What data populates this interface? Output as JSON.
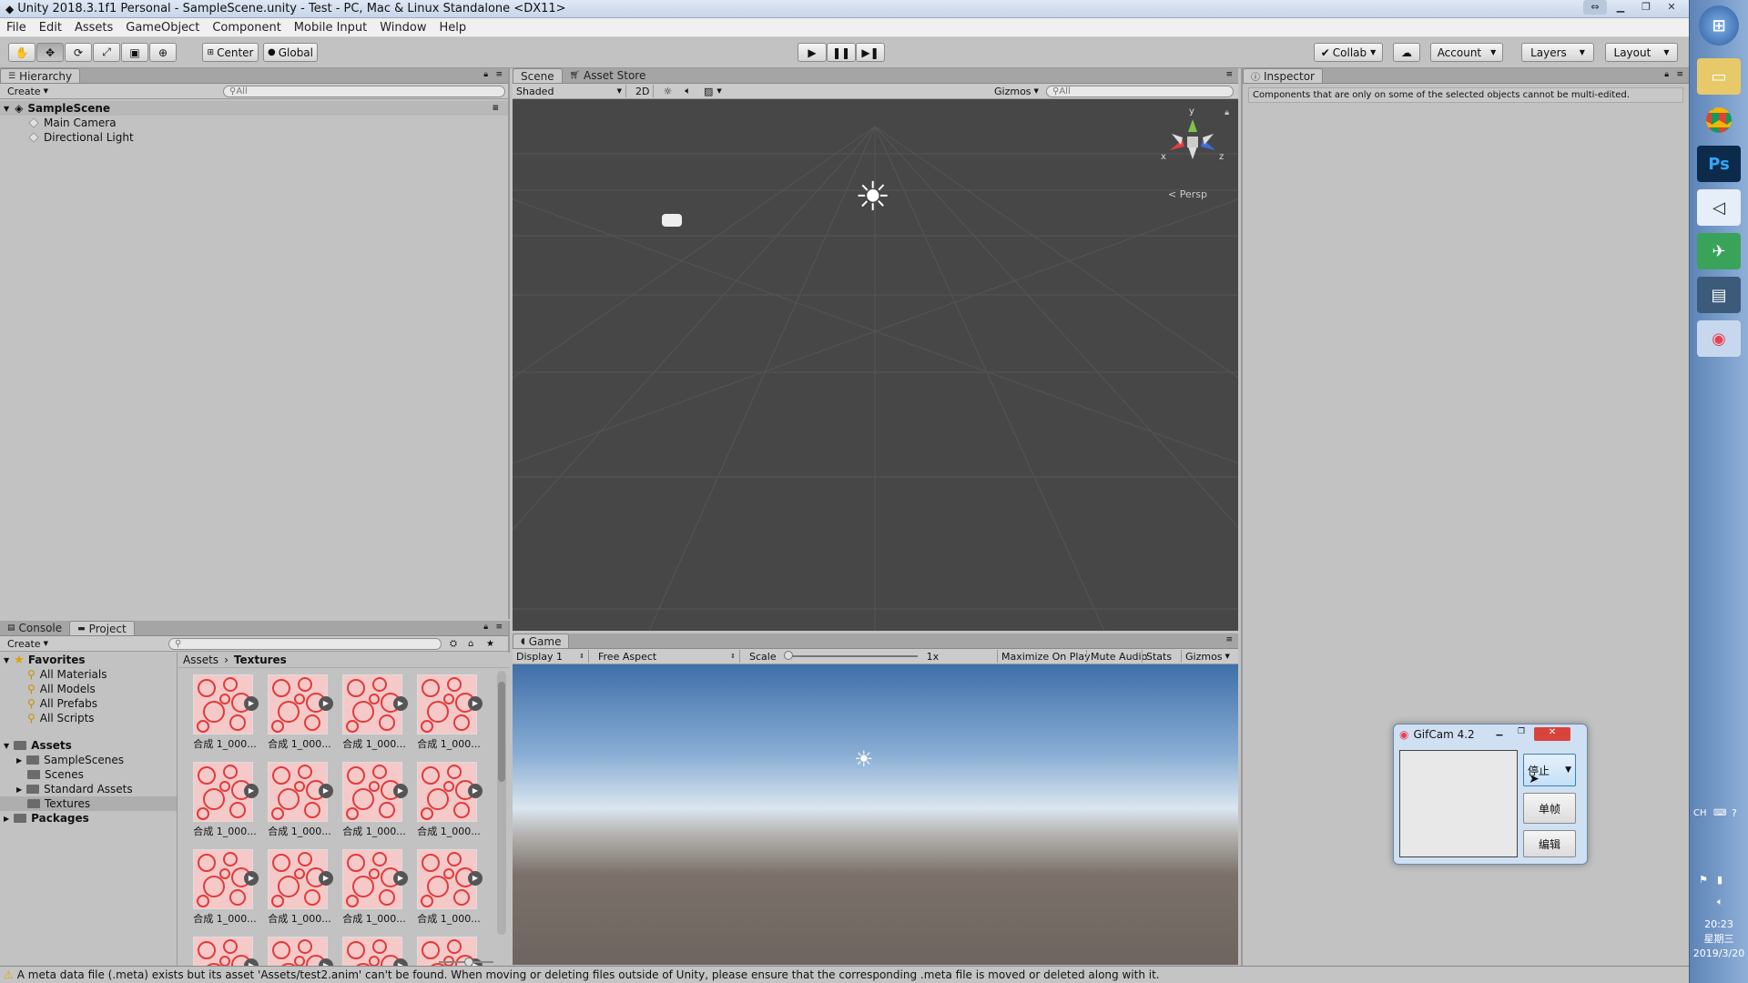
{
  "window": {
    "title": "Unity 2018.3.1f1 Personal - SampleScene.unity - Test - PC, Mac & Linux Standalone <DX11>"
  },
  "menu": [
    "File",
    "Edit",
    "Assets",
    "GameObject",
    "Component",
    "Mobile Input",
    "Window",
    "Help"
  ],
  "toolbar": {
    "pivot": "Center",
    "space": "Global",
    "collab": "Collab",
    "account": "Account",
    "layers": "Layers",
    "layout": "Layout"
  },
  "hierarchy": {
    "tab": "Hierarchy",
    "create": "Create",
    "search_placeholder": "All",
    "scene": "SampleScene",
    "items": [
      "Main Camera",
      "Directional Light"
    ]
  },
  "scene_view": {
    "tabs": [
      "Scene",
      "Asset Store"
    ],
    "shading": "Shaded",
    "mode_2d": "2D",
    "gizmos": "Gizmos",
    "search_placeholder": "All",
    "persp": "Persp",
    "axes": {
      "x": "x",
      "y": "y",
      "z": "z"
    }
  },
  "inspector": {
    "tab": "Inspector",
    "message": "Components that are only on some of the selected objects cannot be multi-edited."
  },
  "project": {
    "tabs": [
      "Console",
      "Project"
    ],
    "create": "Create",
    "favorites_label": "Favorites",
    "favorites": [
      "All Materials",
      "All Models",
      "All Prefabs",
      "All Scripts"
    ],
    "assets_label": "Assets",
    "assets": [
      "SampleScenes",
      "Scenes",
      "Standard Assets",
      "Textures"
    ],
    "packages_label": "Packages",
    "breadcrumb": [
      "Assets",
      "Textures"
    ],
    "thumb_caption": "合成 1_000..."
  },
  "game_view": {
    "tab": "Game",
    "display": "Display 1",
    "aspect": "Free Aspect",
    "scale_label": "Scale",
    "scale_value": "1x",
    "maximize": "Maximize On Play",
    "mute": "Mute Audio",
    "stats": "Stats",
    "gizmos": "Gizmos"
  },
  "gifcam": {
    "title": "GifCam 4.2",
    "stop": "停止",
    "frame": "单帧",
    "edit": "编辑"
  },
  "status": {
    "message": "A meta data file (.meta) exists but its asset 'Assets/test2.anim' can't be found. When moving or deleting files outside of Unity, please ensure that the corresponding .meta file is moved or deleted along with it."
  },
  "taskbar": {
    "lang": "CH",
    "time": "20:23",
    "weekday": "星期三",
    "date": "2019/3/20"
  },
  "colors": {
    "scene_bg": "#474747",
    "sky_top": "#3f6fa8",
    "ground": "#6e6560",
    "texture_red": "#e23a3a"
  }
}
